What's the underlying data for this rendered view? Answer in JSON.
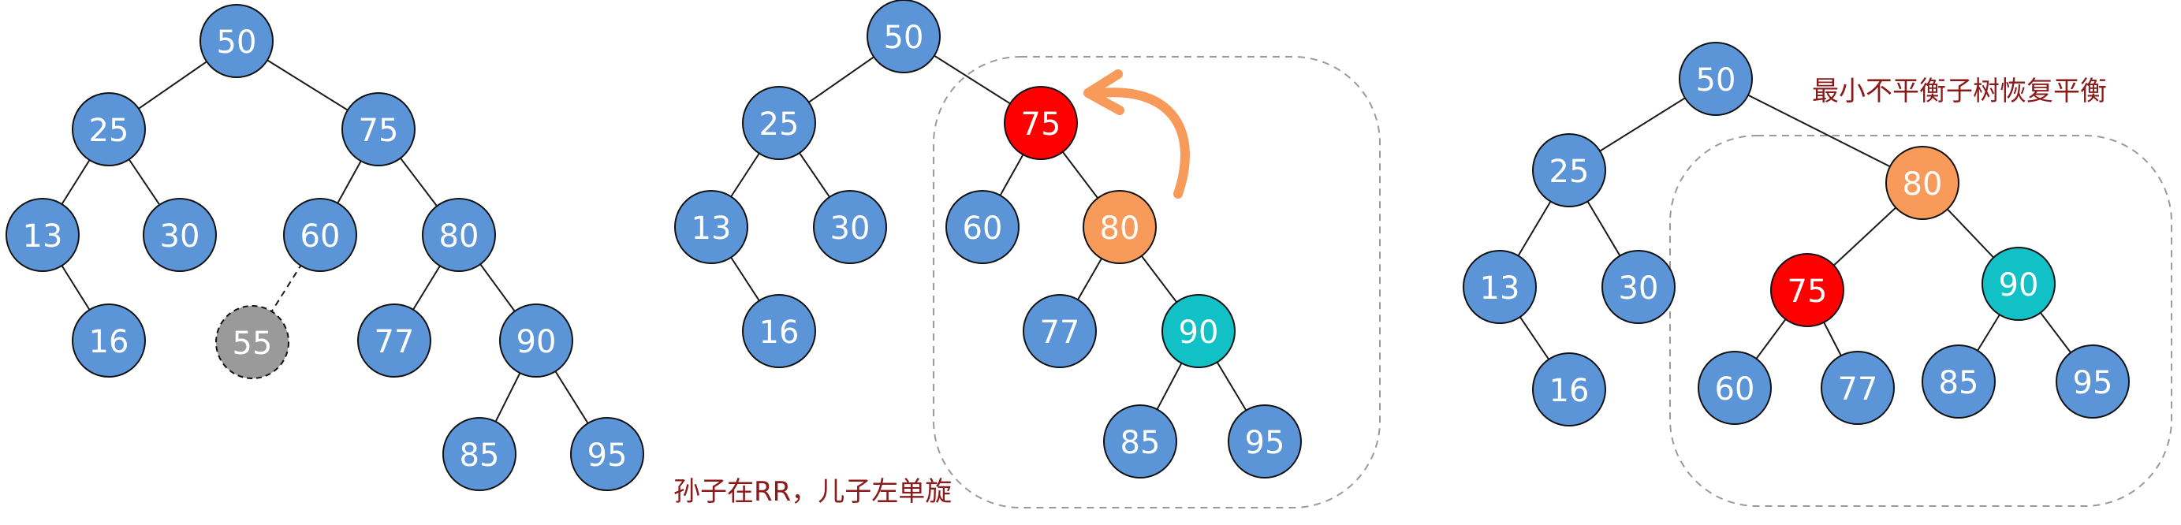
{
  "colors": {
    "node_blue": "#5b95d8",
    "node_red": "#ff0000",
    "node_orange": "#f79a5a",
    "node_cyan": "#11c1c6",
    "node_gray": "#9a9a9a",
    "arrow_orange": "#f79a5a",
    "caption_text": "#8b1a1a",
    "edge": "#1a1a1a",
    "dashed_box": "#9a9a9a"
  },
  "captions": {
    "step2": "孙子在RR，儿子左单旋",
    "step3": "最小不平衡子树恢复平衡"
  },
  "trees": [
    {
      "id": "tree-original",
      "nodes": [
        {
          "id": "50",
          "label": "50",
          "color": "node_blue"
        },
        {
          "id": "25",
          "label": "25",
          "color": "node_blue"
        },
        {
          "id": "75",
          "label": "75",
          "color": "node_blue"
        },
        {
          "id": "13",
          "label": "13",
          "color": "node_blue"
        },
        {
          "id": "30",
          "label": "30",
          "color": "node_blue"
        },
        {
          "id": "60",
          "label": "60",
          "color": "node_blue"
        },
        {
          "id": "80",
          "label": "80",
          "color": "node_blue"
        },
        {
          "id": "16",
          "label": "16",
          "color": "node_blue"
        },
        {
          "id": "55",
          "label": "55",
          "color": "node_gray",
          "dashed": true
        },
        {
          "id": "77",
          "label": "77",
          "color": "node_blue"
        },
        {
          "id": "90",
          "label": "90",
          "color": "node_blue"
        },
        {
          "id": "85",
          "label": "85",
          "color": "node_blue"
        },
        {
          "id": "95",
          "label": "95",
          "color": "node_blue"
        }
      ],
      "edges": [
        [
          "50",
          "25"
        ],
        [
          "50",
          "75"
        ],
        [
          "25",
          "13"
        ],
        [
          "25",
          "30"
        ],
        [
          "13",
          "16"
        ],
        [
          "75",
          "60"
        ],
        [
          "75",
          "80"
        ],
        [
          "60",
          "55",
          "dashed"
        ],
        [
          "80",
          "77"
        ],
        [
          "80",
          "90"
        ],
        [
          "90",
          "85"
        ],
        [
          "90",
          "95"
        ]
      ]
    },
    {
      "id": "tree-rotating",
      "nodes": [
        {
          "id": "50",
          "label": "50",
          "color": "node_blue"
        },
        {
          "id": "25",
          "label": "25",
          "color": "node_blue"
        },
        {
          "id": "75",
          "label": "75",
          "color": "node_red"
        },
        {
          "id": "13",
          "label": "13",
          "color": "node_blue"
        },
        {
          "id": "30",
          "label": "30",
          "color": "node_blue"
        },
        {
          "id": "60",
          "label": "60",
          "color": "node_blue"
        },
        {
          "id": "80",
          "label": "80",
          "color": "node_orange"
        },
        {
          "id": "16",
          "label": "16",
          "color": "node_blue"
        },
        {
          "id": "77",
          "label": "77",
          "color": "node_blue"
        },
        {
          "id": "90",
          "label": "90",
          "color": "node_cyan"
        },
        {
          "id": "85",
          "label": "85",
          "color": "node_blue"
        },
        {
          "id": "95",
          "label": "95",
          "color": "node_blue"
        }
      ],
      "edges": [
        [
          "50",
          "25"
        ],
        [
          "50",
          "75"
        ],
        [
          "25",
          "13"
        ],
        [
          "25",
          "30"
        ],
        [
          "13",
          "16"
        ],
        [
          "75",
          "60"
        ],
        [
          "75",
          "80"
        ],
        [
          "80",
          "77"
        ],
        [
          "80",
          "90"
        ],
        [
          "90",
          "85"
        ],
        [
          "90",
          "95"
        ]
      ]
    },
    {
      "id": "tree-balanced",
      "nodes": [
        {
          "id": "50",
          "label": "50",
          "color": "node_blue"
        },
        {
          "id": "25",
          "label": "25",
          "color": "node_blue"
        },
        {
          "id": "80",
          "label": "80",
          "color": "node_orange"
        },
        {
          "id": "13",
          "label": "13",
          "color": "node_blue"
        },
        {
          "id": "30",
          "label": "30",
          "color": "node_blue"
        },
        {
          "id": "75",
          "label": "75",
          "color": "node_red"
        },
        {
          "id": "90",
          "label": "90",
          "color": "node_cyan"
        },
        {
          "id": "16",
          "label": "16",
          "color": "node_blue"
        },
        {
          "id": "60",
          "label": "60",
          "color": "node_blue"
        },
        {
          "id": "77",
          "label": "77",
          "color": "node_blue"
        },
        {
          "id": "85",
          "label": "85",
          "color": "node_blue"
        },
        {
          "id": "95",
          "label": "95",
          "color": "node_blue"
        }
      ],
      "edges": [
        [
          "50",
          "25"
        ],
        [
          "50",
          "80"
        ],
        [
          "25",
          "13"
        ],
        [
          "25",
          "30"
        ],
        [
          "13",
          "16"
        ],
        [
          "80",
          "75"
        ],
        [
          "80",
          "90"
        ],
        [
          "75",
          "60"
        ],
        [
          "75",
          "77"
        ],
        [
          "90",
          "85"
        ],
        [
          "90",
          "95"
        ]
      ]
    }
  ]
}
